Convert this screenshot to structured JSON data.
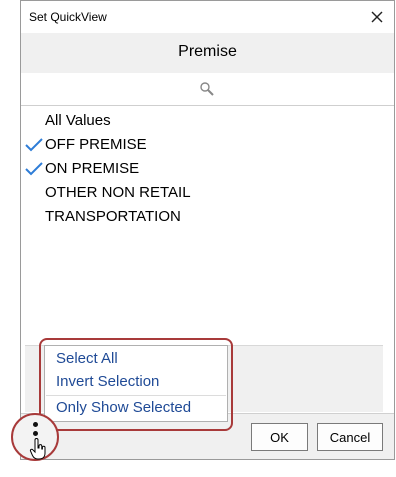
{
  "dialog": {
    "title": "Set QuickView",
    "close_icon": "close-icon",
    "header": "Premise",
    "search_icon": "magnifier-icon",
    "values": [
      {
        "label": "All Values",
        "checked": false
      },
      {
        "label": "OFF PREMISE",
        "checked": true
      },
      {
        "label": "ON PREMISE",
        "checked": true
      },
      {
        "label": "OTHER NON RETAIL",
        "checked": false
      },
      {
        "label": "TRANSPORTATION",
        "checked": false
      }
    ],
    "check_color": "#2e7dd7"
  },
  "context_menu": {
    "items": [
      "Select All",
      "Invert Selection",
      "Only Show Selected"
    ],
    "text_color": "#1f4a96"
  },
  "footer": {
    "ok_label": "OK",
    "cancel_label": "Cancel",
    "more_icon": "vertical-dots-icon",
    "cursor_icon": "hand-cursor-icon"
  },
  "annotation_color": "#a83a3a"
}
